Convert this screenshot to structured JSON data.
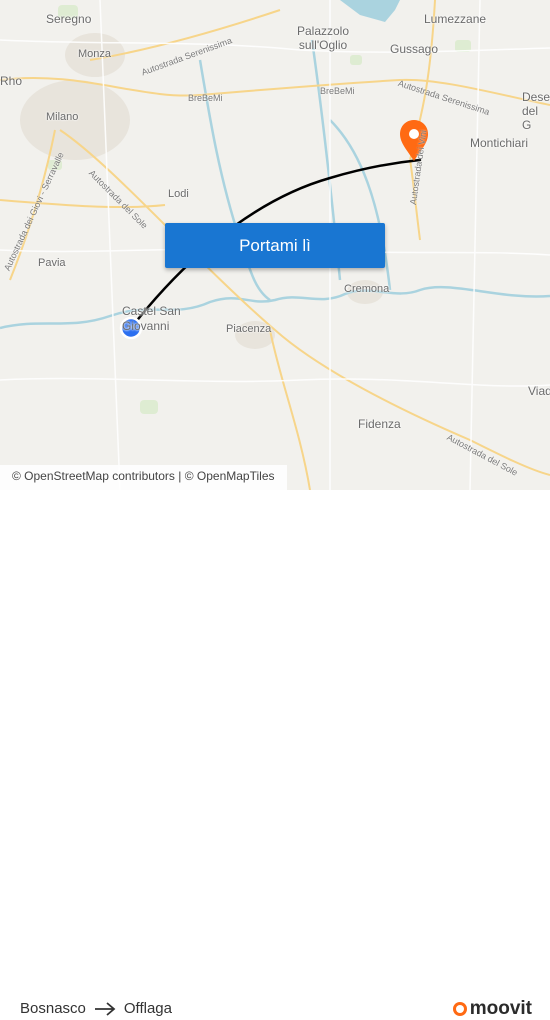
{
  "map": {
    "places": [
      {
        "key": "seregno",
        "label": "Seregno"
      },
      {
        "key": "monza",
        "label": "Monza"
      },
      {
        "key": "rho",
        "label": "Rho"
      },
      {
        "key": "milano",
        "label": "Milano"
      },
      {
        "key": "lodi",
        "label": "Lodi"
      },
      {
        "key": "pavia",
        "label": "Pavia"
      },
      {
        "key": "castel_san_giovanni",
        "label": "Castel San Giovanni"
      },
      {
        "key": "piacenza",
        "label": "Piacenza"
      },
      {
        "key": "cremona",
        "label": "Cremona"
      },
      {
        "key": "fidenza",
        "label": "Fidenza"
      },
      {
        "key": "palazzolo",
        "label": "Palazzolo sull'Oglio"
      },
      {
        "key": "lumezzane",
        "label": "Lumezzane"
      },
      {
        "key": "gussago",
        "label": "Gussago"
      },
      {
        "key": "montichiari",
        "label": "Montichiari"
      },
      {
        "key": "desenzano",
        "label": "Dese del G"
      },
      {
        "key": "viadana",
        "label": "Viad"
      }
    ],
    "roads": [
      {
        "key": "serenissima_west",
        "label": "Autostrada Serenissima"
      },
      {
        "key": "serenissima_east",
        "label": "Autostrada Serenissima"
      },
      {
        "key": "brebemi_west",
        "label": "BreBeMi"
      },
      {
        "key": "brebemi_east",
        "label": "BreBeMi"
      },
      {
        "key": "del_sole_north",
        "label": "Autostrada del Sole"
      },
      {
        "key": "dei_giovi",
        "label": "Autostrada dei Giovi - Serravalle"
      },
      {
        "key": "del_sole_south",
        "label": "Autostrada del Sole"
      },
      {
        "key": "dei_vini",
        "label": "Autostrada dei Vini"
      }
    ],
    "origin_marker": "origin-marker-icon",
    "destination_marker": "destination-pin-icon",
    "route_color": "#000000",
    "origin_color": "#2b6ff0",
    "destination_color": "#ff6a13",
    "water_color": "#aad3df"
  },
  "cta": {
    "label": "Portami lì",
    "color": "#1976d2"
  },
  "attribution": {
    "osm": "© OpenStreetMap contributors",
    "separator": "|",
    "omt": "© OpenMapTiles"
  },
  "footer": {
    "origin": "Bosnasco",
    "arrow_icon": "arrow-right-icon",
    "destination": "Offlaga",
    "brand": "moovit",
    "brand_color": "#ff6a13"
  }
}
